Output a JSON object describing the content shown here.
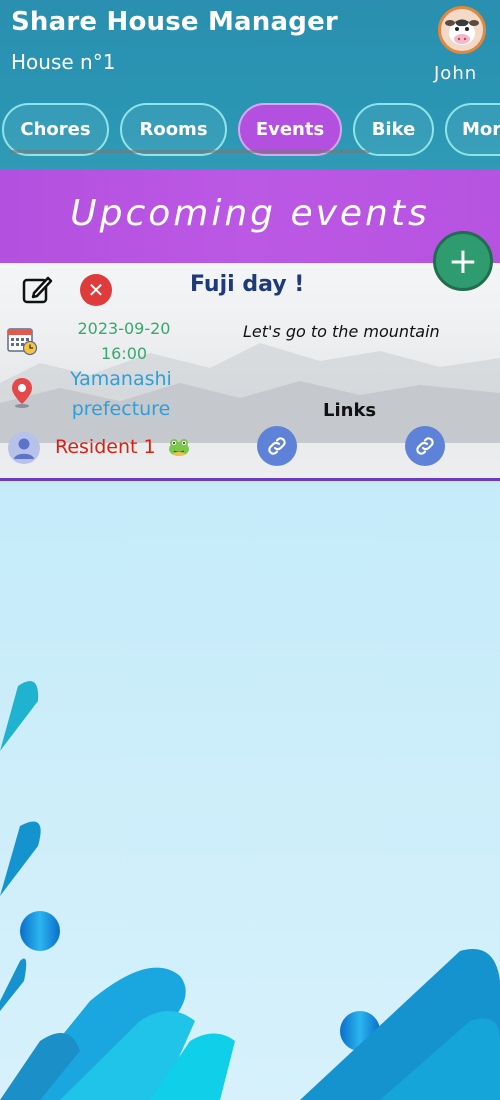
{
  "header": {
    "app_title": "Share House Manager",
    "house_name": "House n°1",
    "user_name": "John"
  },
  "tabs": [
    {
      "label": "Chores",
      "active": false
    },
    {
      "label": "Rooms",
      "active": false
    },
    {
      "label": "Events",
      "active": true
    },
    {
      "label": "Bike",
      "active": false
    },
    {
      "label": "Mor",
      "active": false
    }
  ],
  "banner": {
    "title": "Upcoming events",
    "add_label": "+"
  },
  "event": {
    "title": "Fuji day !",
    "date": "2023-09-20",
    "time": "16:00",
    "description": "Let's go to the mountain",
    "location_line1": "Yamanashi",
    "location_line2": "prefecture",
    "links_label": "Links",
    "resident": "Resident 1"
  },
  "colors": {
    "header": "#2a8fb0",
    "active_tab": "#b450e0",
    "banner": "#b450df",
    "add_button": "#2e9c6e",
    "date_text": "#3aa76d",
    "location_text": "#2e9fd8",
    "resident_text": "#dd1f12",
    "link_button": "#5f82d9"
  },
  "icons": [
    "cow-avatar-icon",
    "edit-icon",
    "close-icon",
    "calendar-icon",
    "location-pin-icon",
    "person-icon",
    "frog-icon",
    "link-icon",
    "plus-icon"
  ]
}
